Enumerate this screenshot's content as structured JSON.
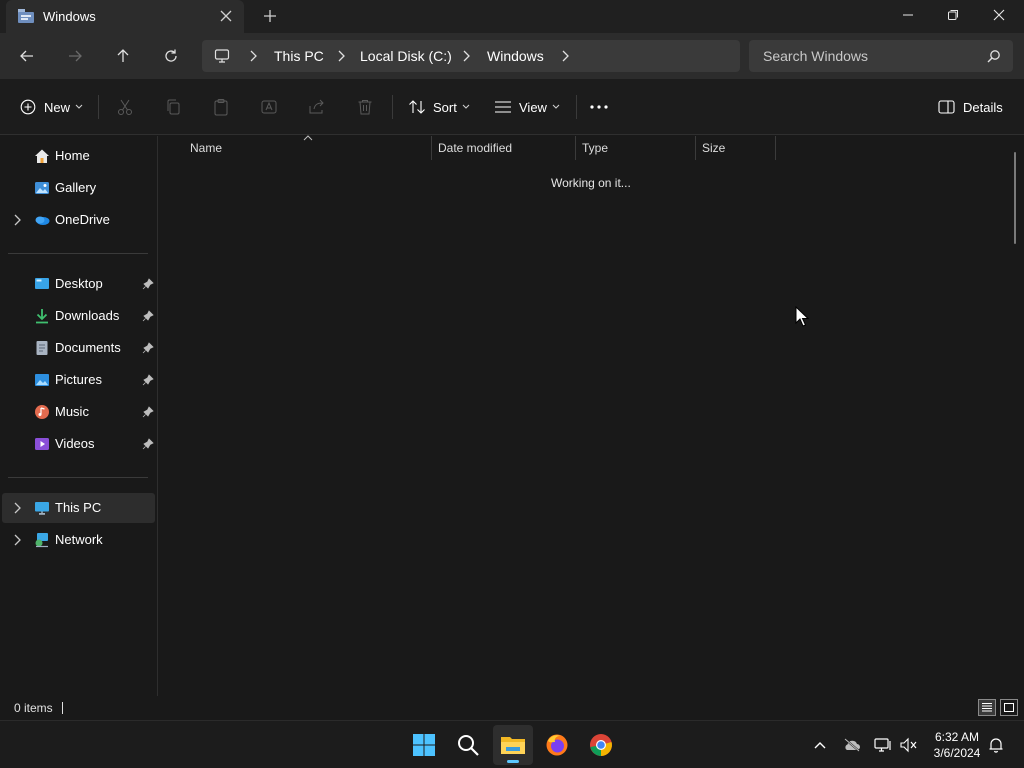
{
  "window": {
    "tab_title": "Windows",
    "new_tab_symbol": "+"
  },
  "address": {
    "breadcrumbs": [
      "This PC",
      "Local Disk (C:)",
      "Windows"
    ],
    "search_placeholder": "Search Windows"
  },
  "commands": {
    "new_label": "New",
    "sort_label": "Sort",
    "view_label": "View",
    "details_label": "Details"
  },
  "sidebar": {
    "items": [
      {
        "label": "Home",
        "icon": "home-icon"
      },
      {
        "label": "Gallery",
        "icon": "gallery-icon"
      },
      {
        "label": "OneDrive",
        "icon": "onedrive-icon"
      },
      {
        "label": "Desktop",
        "icon": "desktop-icon"
      },
      {
        "label": "Downloads",
        "icon": "downloads-icon"
      },
      {
        "label": "Documents",
        "icon": "documents-icon"
      },
      {
        "label": "Pictures",
        "icon": "pictures-icon"
      },
      {
        "label": "Music",
        "icon": "music-icon"
      },
      {
        "label": "Videos",
        "icon": "videos-icon"
      },
      {
        "label": "This PC",
        "icon": "this-pc-icon"
      },
      {
        "label": "Network",
        "icon": "network-icon"
      }
    ]
  },
  "columns": [
    "Name",
    "Date modified",
    "Type",
    "Size"
  ],
  "content": {
    "loading_text": "Working on it..."
  },
  "status": {
    "item_count": "0 items"
  },
  "taskbar": {
    "time": "6:32 AM",
    "date": "3/6/2024"
  },
  "colors": {
    "accent": "#5cc8ff",
    "background": "#191919",
    "title_bar": "#202020",
    "address_bar": "#2c2c2c"
  }
}
